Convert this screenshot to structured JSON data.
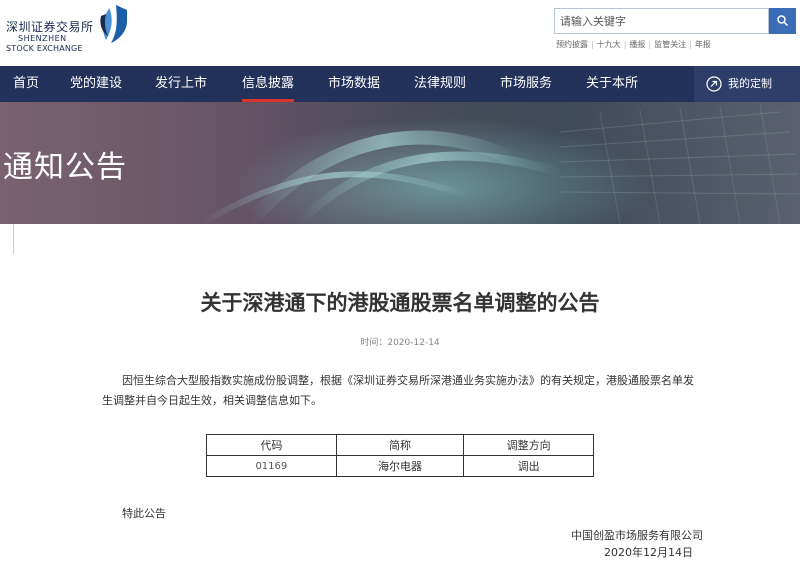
{
  "header": {
    "logo_cn": "深圳证券交易所",
    "logo_en_line1": "SHENZHEN",
    "logo_en_line2": "STOCK EXCHANGE",
    "search_placeholder": "请输入关键字",
    "quick_links": [
      "预约披露",
      "十九大",
      "播报",
      "监管关注",
      "年报"
    ]
  },
  "nav": {
    "items": [
      "首页",
      "党的建设",
      "发行上市",
      "信息披露",
      "市场数据",
      "法律规则",
      "市场服务",
      "关于本所"
    ],
    "active": "信息披露",
    "custom_label": "我的定制"
  },
  "banner": {
    "title": "通知公告"
  },
  "article": {
    "title": "关于深港通下的港股通股票名单调整的公告",
    "time": "时间：2020-12-14",
    "paragraph": "因恒生综合大型股指数实施成份股调整，根据《深圳证券交易所深港通业务实施办法》的有关规定，港股通股票名单发生调整并自今日起生效，相关调整信息如下。",
    "table": {
      "headers": [
        "代码",
        "简称",
        "调整方向"
      ],
      "rows": [
        [
          "01169",
          "海尔电器",
          "调出"
        ]
      ]
    },
    "closing": "特此公告",
    "signer": "中国创盈市场服务有限公司",
    "date": "2020年12月14日"
  },
  "colors": {
    "nav_bg": "#23325a",
    "nav_active_underline": "#d9332e",
    "search_button": "#3a6db5"
  },
  "icons": {
    "search": "search-icon",
    "custom": "custom-circle-icon",
    "logo": "szse-logo-mark"
  }
}
